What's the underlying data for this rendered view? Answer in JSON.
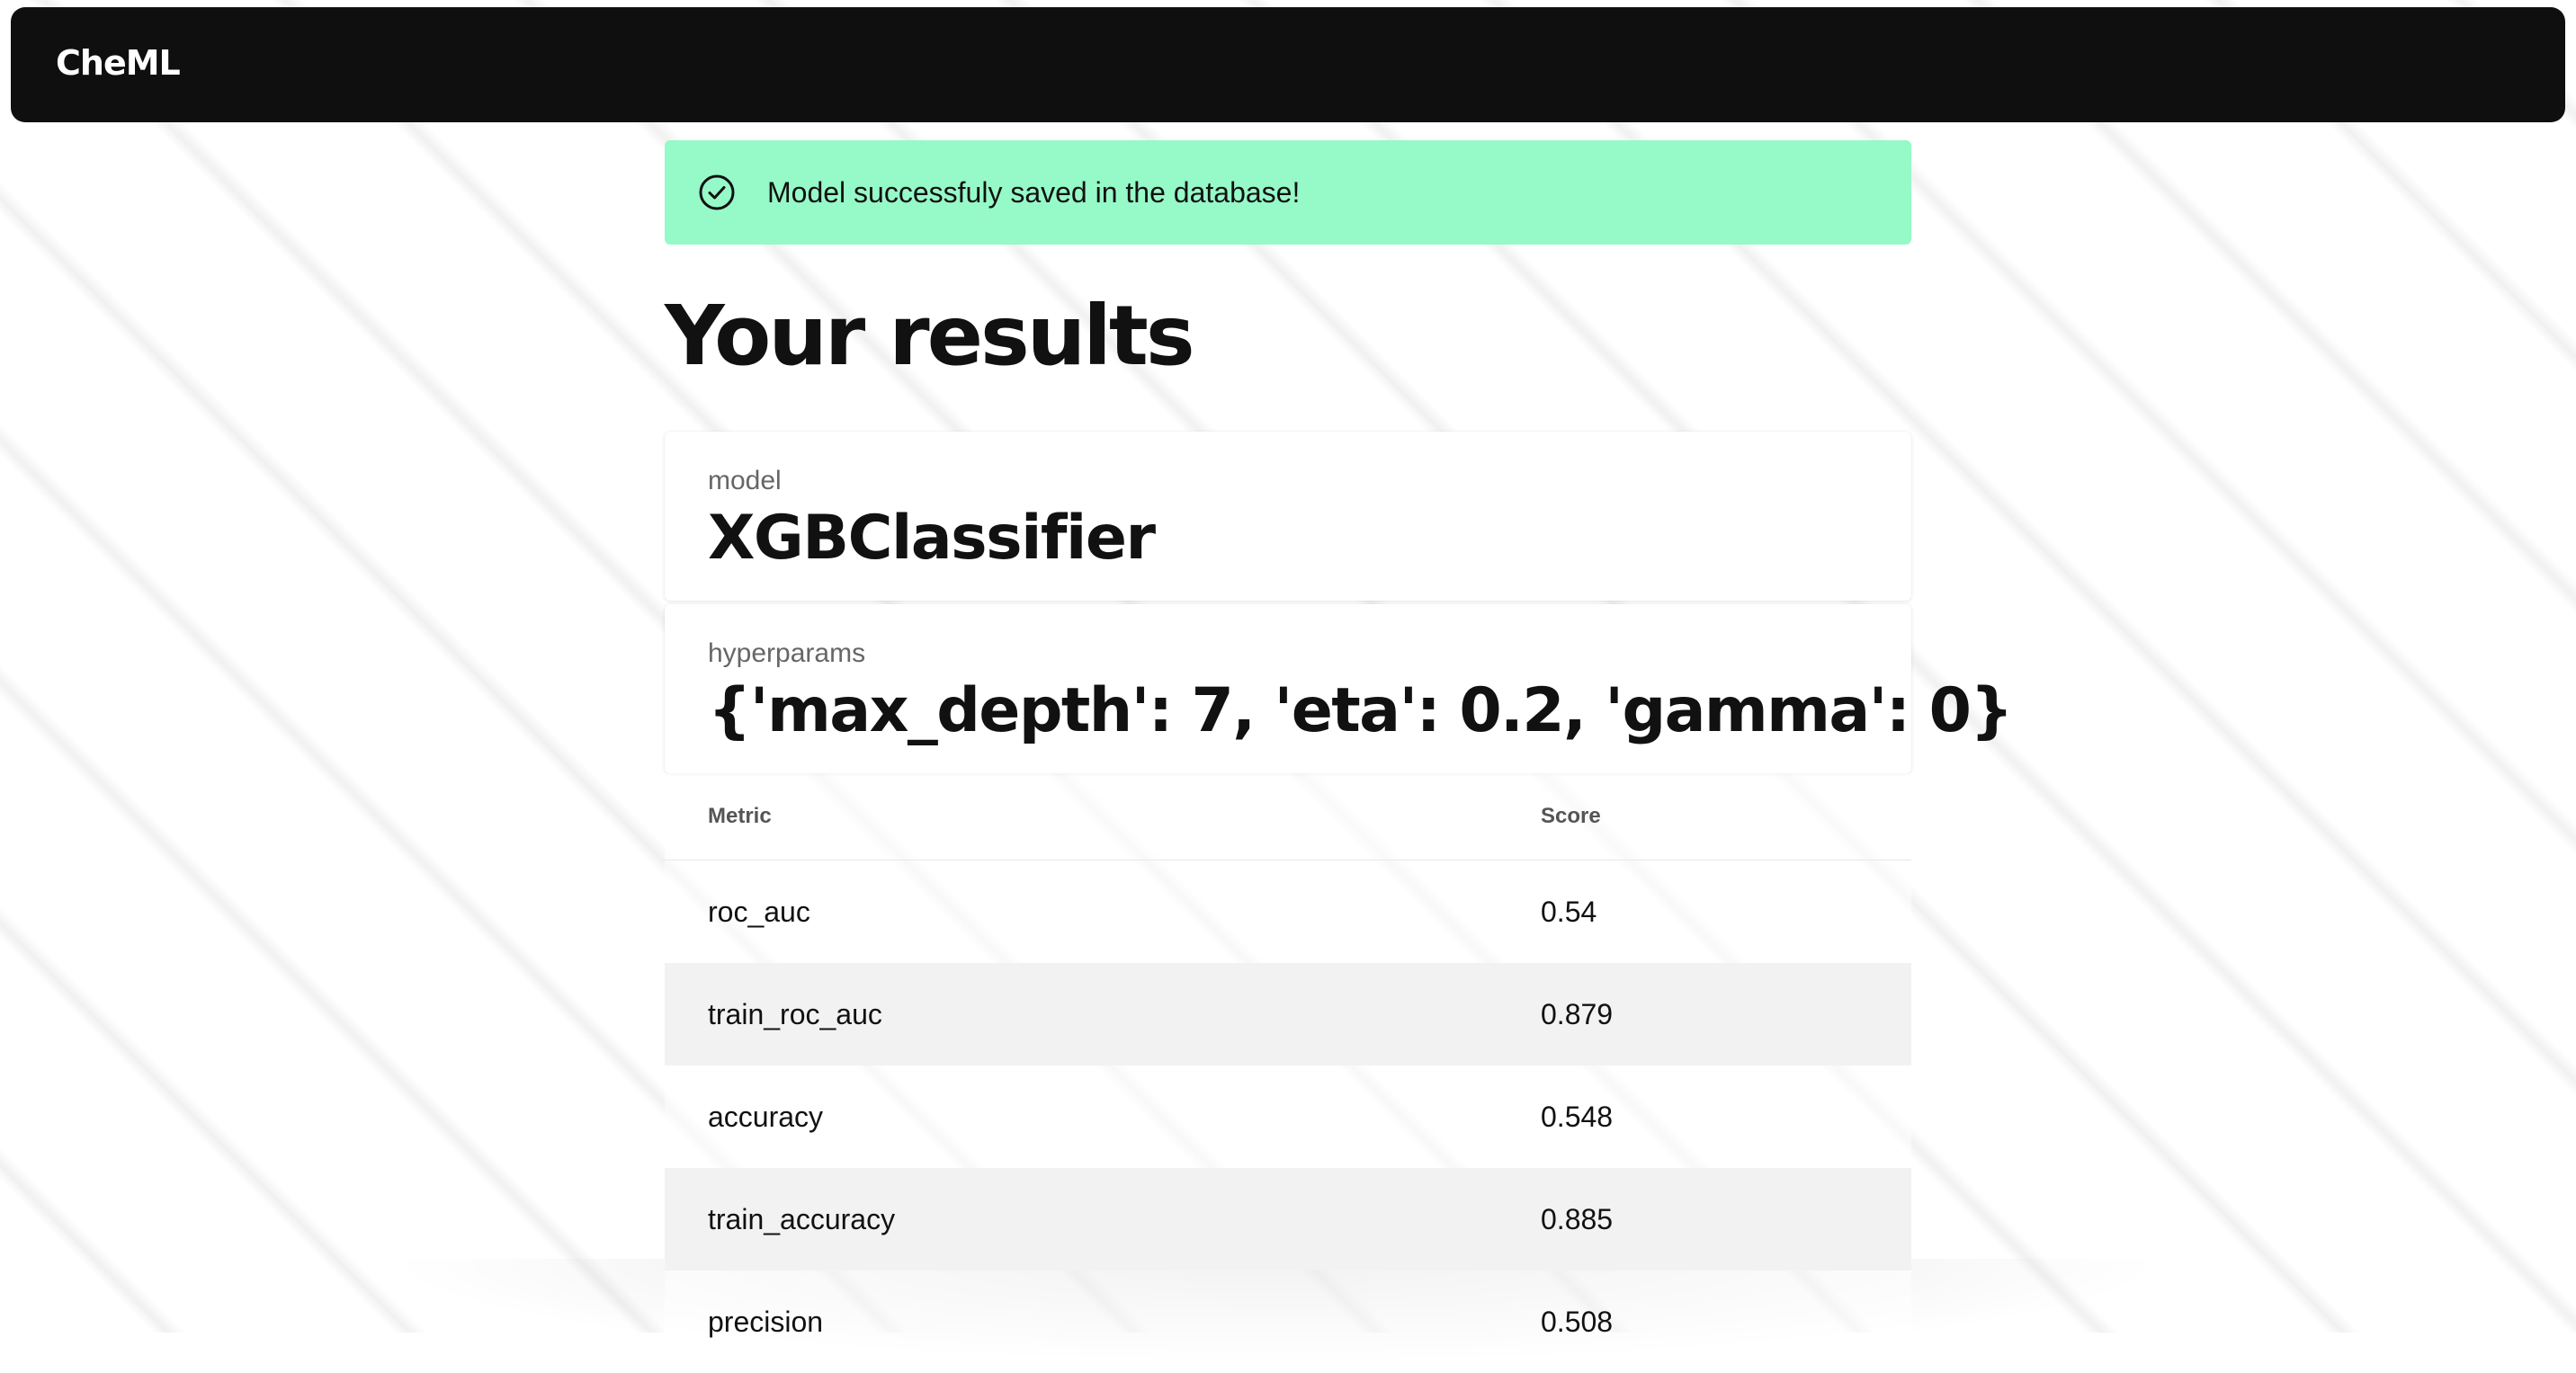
{
  "app": {
    "brand": "CheML"
  },
  "alert": {
    "icon": "check-circle-icon",
    "message": "Model successfuly saved in the database!",
    "color": "#96f9c8"
  },
  "page": {
    "title": "Your results"
  },
  "model_card": {
    "label": "model",
    "value": "XGBClassifier"
  },
  "hyperparams_card": {
    "label": "hyperparams",
    "value": "{'max_depth': 7, 'eta': 0.2, 'gamma': 0}"
  },
  "table": {
    "headers": [
      "Metric",
      "Score"
    ],
    "rows": [
      {
        "metric": "roc_auc",
        "score": "0.54"
      },
      {
        "metric": "train_roc_auc",
        "score": "0.879"
      },
      {
        "metric": "accuracy",
        "score": "0.548"
      },
      {
        "metric": "train_accuracy",
        "score": "0.885"
      },
      {
        "metric": "precision",
        "score": "0.508"
      }
    ]
  }
}
